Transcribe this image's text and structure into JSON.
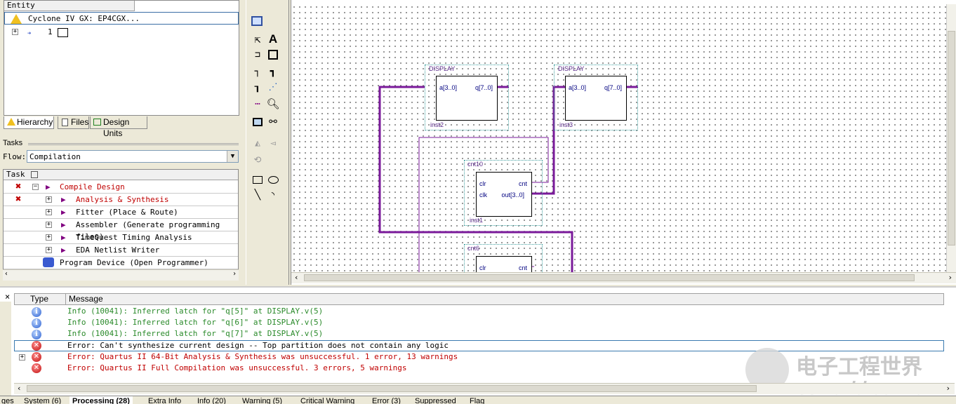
{
  "hierarchy": {
    "header": "Entity",
    "rows": [
      {
        "label": "Cyclone IV GX: EP4CGX..."
      },
      {
        "label": "1"
      }
    ]
  },
  "left_tabs": [
    "Hierarchy",
    "Files",
    "Design Units"
  ],
  "tasks": {
    "title": "Tasks",
    "flow_label": "Flow:",
    "flow_value": "Compilation",
    "header": "Task",
    "rows": [
      {
        "label": "Compile Design",
        "status": "error"
      },
      {
        "label": "Analysis & Synthesis",
        "status": "error"
      },
      {
        "label": "Fitter (Place & Route)"
      },
      {
        "label": "Assembler (Generate programming files)"
      },
      {
        "label": "TimeQuest Timing Analysis"
      },
      {
        "label": "EDA Netlist Writer"
      },
      {
        "label": "Program Device (Open Programmer)"
      }
    ]
  },
  "schematic": {
    "blocks": [
      {
        "type": "DISPLAY",
        "inst": "inst2",
        "ports": [
          "a[3..0]",
          "q[7..0]"
        ]
      },
      {
        "type": "DISPLAY",
        "inst": "inst3",
        "ports": [
          "a[3..0]",
          "q[7..0]"
        ]
      },
      {
        "type": "cnt10",
        "inst": "inst1",
        "ports": [
          "clr",
          "cnt",
          "clk",
          "out[3..0]"
        ]
      },
      {
        "type": "cnt6",
        "ports": [
          "clr",
          "cnt"
        ]
      }
    ]
  },
  "messages": {
    "col_type": "Type",
    "col_message": "Message",
    "rows": [
      {
        "kind": "info",
        "text": "Info (10041): Inferred latch for \"q[5]\" at DISPLAY.v(5)"
      },
      {
        "kind": "info",
        "text": "Info (10041): Inferred latch for \"q[6]\" at DISPLAY.v(5)"
      },
      {
        "kind": "info",
        "text": "Info (10041): Inferred latch for \"q[7]\" at DISPLAY.v(5)"
      },
      {
        "kind": "error",
        "text": "Error: Can't synthesize current design -- Top partition does not contain any logic"
      },
      {
        "kind": "error",
        "text": "Error: Quartus II 64-Bit Analysis & Synthesis was unsuccessful. 1 error, 13 warnings"
      },
      {
        "kind": "error",
        "text": "Error: Quartus II Full Compilation was unsuccessful. 3 errors, 5 warnings"
      }
    ],
    "tabs": [
      "System (6)",
      "Processing (28)",
      "Extra Info",
      "Info (20)",
      "Warning (5)",
      "Critical Warning",
      "Error (3)",
      "Suppressed",
      "Flag"
    ],
    "side_label": "ges"
  },
  "watermark": {
    "cn": "电子工程世界",
    "en": "eeworld.com.cn"
  },
  "colors": {
    "wire": "#7a1a9a",
    "error_text": "#c00000",
    "info_text": "#2a8a2a"
  }
}
